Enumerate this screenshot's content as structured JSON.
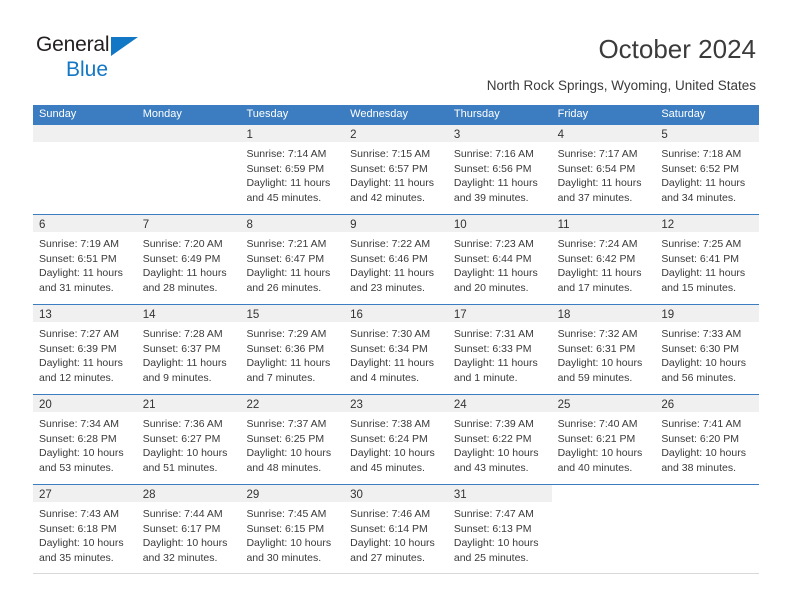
{
  "brand": {
    "name_part1": "General",
    "name_part2": "Blue",
    "accent_color": "#1277c4"
  },
  "header": {
    "title": "October 2024",
    "location": "North Rock Springs, Wyoming, United States"
  },
  "colors": {
    "header_band": "#3b7dc0",
    "date_bar": "#f0f0f0",
    "text": "#3a3a3a"
  },
  "weekday_headers": [
    "Sunday",
    "Monday",
    "Tuesday",
    "Wednesday",
    "Thursday",
    "Friday",
    "Saturday"
  ],
  "weeks": [
    [
      {
        "day": "",
        "blank": true,
        "lines": []
      },
      {
        "day": "",
        "blank": true,
        "lines": []
      },
      {
        "day": "1",
        "lines": [
          "Sunrise: 7:14 AM",
          "Sunset: 6:59 PM",
          "Daylight: 11 hours",
          "and 45 minutes."
        ]
      },
      {
        "day": "2",
        "lines": [
          "Sunrise: 7:15 AM",
          "Sunset: 6:57 PM",
          "Daylight: 11 hours",
          "and 42 minutes."
        ]
      },
      {
        "day": "3",
        "lines": [
          "Sunrise: 7:16 AM",
          "Sunset: 6:56 PM",
          "Daylight: 11 hours",
          "and 39 minutes."
        ]
      },
      {
        "day": "4",
        "lines": [
          "Sunrise: 7:17 AM",
          "Sunset: 6:54 PM",
          "Daylight: 11 hours",
          "and 37 minutes."
        ]
      },
      {
        "day": "5",
        "lines": [
          "Sunrise: 7:18 AM",
          "Sunset: 6:52 PM",
          "Daylight: 11 hours",
          "and 34 minutes."
        ]
      }
    ],
    [
      {
        "day": "6",
        "lines": [
          "Sunrise: 7:19 AM",
          "Sunset: 6:51 PM",
          "Daylight: 11 hours",
          "and 31 minutes."
        ]
      },
      {
        "day": "7",
        "lines": [
          "Sunrise: 7:20 AM",
          "Sunset: 6:49 PM",
          "Daylight: 11 hours",
          "and 28 minutes."
        ]
      },
      {
        "day": "8",
        "lines": [
          "Sunrise: 7:21 AM",
          "Sunset: 6:47 PM",
          "Daylight: 11 hours",
          "and 26 minutes."
        ]
      },
      {
        "day": "9",
        "lines": [
          "Sunrise: 7:22 AM",
          "Sunset: 6:46 PM",
          "Daylight: 11 hours",
          "and 23 minutes."
        ]
      },
      {
        "day": "10",
        "lines": [
          "Sunrise: 7:23 AM",
          "Sunset: 6:44 PM",
          "Daylight: 11 hours",
          "and 20 minutes."
        ]
      },
      {
        "day": "11",
        "lines": [
          "Sunrise: 7:24 AM",
          "Sunset: 6:42 PM",
          "Daylight: 11 hours",
          "and 17 minutes."
        ]
      },
      {
        "day": "12",
        "lines": [
          "Sunrise: 7:25 AM",
          "Sunset: 6:41 PM",
          "Daylight: 11 hours",
          "and 15 minutes."
        ]
      }
    ],
    [
      {
        "day": "13",
        "lines": [
          "Sunrise: 7:27 AM",
          "Sunset: 6:39 PM",
          "Daylight: 11 hours",
          "and 12 minutes."
        ]
      },
      {
        "day": "14",
        "lines": [
          "Sunrise: 7:28 AM",
          "Sunset: 6:37 PM",
          "Daylight: 11 hours",
          "and 9 minutes."
        ]
      },
      {
        "day": "15",
        "lines": [
          "Sunrise: 7:29 AM",
          "Sunset: 6:36 PM",
          "Daylight: 11 hours",
          "and 7 minutes."
        ]
      },
      {
        "day": "16",
        "lines": [
          "Sunrise: 7:30 AM",
          "Sunset: 6:34 PM",
          "Daylight: 11 hours",
          "and 4 minutes."
        ]
      },
      {
        "day": "17",
        "lines": [
          "Sunrise: 7:31 AM",
          "Sunset: 6:33 PM",
          "Daylight: 11 hours",
          "and 1 minute."
        ]
      },
      {
        "day": "18",
        "lines": [
          "Sunrise: 7:32 AM",
          "Sunset: 6:31 PM",
          "Daylight: 10 hours",
          "and 59 minutes."
        ]
      },
      {
        "day": "19",
        "lines": [
          "Sunrise: 7:33 AM",
          "Sunset: 6:30 PM",
          "Daylight: 10 hours",
          "and 56 minutes."
        ]
      }
    ],
    [
      {
        "day": "20",
        "lines": [
          "Sunrise: 7:34 AM",
          "Sunset: 6:28 PM",
          "Daylight: 10 hours",
          "and 53 minutes."
        ]
      },
      {
        "day": "21",
        "lines": [
          "Sunrise: 7:36 AM",
          "Sunset: 6:27 PM",
          "Daylight: 10 hours",
          "and 51 minutes."
        ]
      },
      {
        "day": "22",
        "lines": [
          "Sunrise: 7:37 AM",
          "Sunset: 6:25 PM",
          "Daylight: 10 hours",
          "and 48 minutes."
        ]
      },
      {
        "day": "23",
        "lines": [
          "Sunrise: 7:38 AM",
          "Sunset: 6:24 PM",
          "Daylight: 10 hours",
          "and 45 minutes."
        ]
      },
      {
        "day": "24",
        "lines": [
          "Sunrise: 7:39 AM",
          "Sunset: 6:22 PM",
          "Daylight: 10 hours",
          "and 43 minutes."
        ]
      },
      {
        "day": "25",
        "lines": [
          "Sunrise: 7:40 AM",
          "Sunset: 6:21 PM",
          "Daylight: 10 hours",
          "and 40 minutes."
        ]
      },
      {
        "day": "26",
        "lines": [
          "Sunrise: 7:41 AM",
          "Sunset: 6:20 PM",
          "Daylight: 10 hours",
          "and 38 minutes."
        ]
      }
    ],
    [
      {
        "day": "27",
        "lines": [
          "Sunrise: 7:43 AM",
          "Sunset: 6:18 PM",
          "Daylight: 10 hours",
          "and 35 minutes."
        ]
      },
      {
        "day": "28",
        "lines": [
          "Sunrise: 7:44 AM",
          "Sunset: 6:17 PM",
          "Daylight: 10 hours",
          "and 32 minutes."
        ]
      },
      {
        "day": "29",
        "lines": [
          "Sunrise: 7:45 AM",
          "Sunset: 6:15 PM",
          "Daylight: 10 hours",
          "and 30 minutes."
        ]
      },
      {
        "day": "30",
        "lines": [
          "Sunrise: 7:46 AM",
          "Sunset: 6:14 PM",
          "Daylight: 10 hours",
          "and 27 minutes."
        ]
      },
      {
        "day": "31",
        "lines": [
          "Sunrise: 7:47 AM",
          "Sunset: 6:13 PM",
          "Daylight: 10 hours",
          "and 25 minutes."
        ]
      },
      {
        "day": "",
        "void": true,
        "lines": []
      },
      {
        "day": "",
        "void": true,
        "lines": []
      }
    ]
  ]
}
